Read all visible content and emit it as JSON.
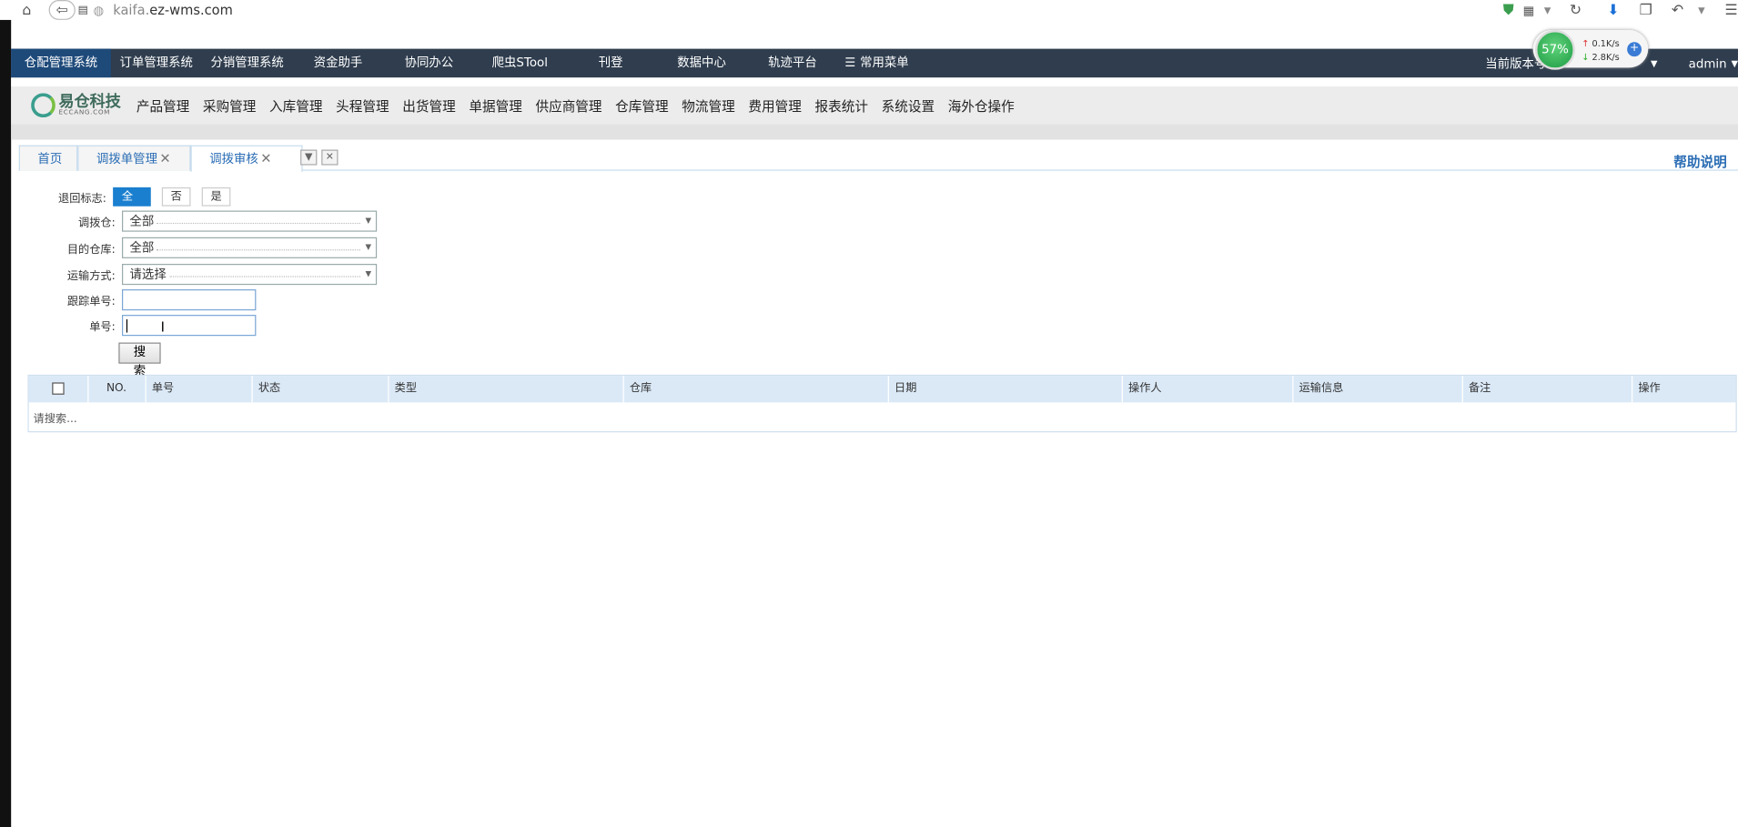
{
  "browser": {
    "url_dim": "kaifa.",
    "url_main": "ez-wms.com",
    "icons": [
      "home-icon",
      "back-icon",
      "reader-icon",
      "globe-icon",
      "shield-icon",
      "qr-icon",
      "reload-icon",
      "download-icon",
      "window-icon",
      "undo-icon",
      "menu-icon"
    ]
  },
  "speed_widget": {
    "percent": "57%",
    "up": "0.1K/s",
    "down": "2.8K/s"
  },
  "topnav": {
    "items": [
      "仓配管理系统",
      "订单管理系统",
      "分销管理系统",
      "资金助手",
      "协同办公",
      "爬虫STool",
      "刊登",
      "数据中心",
      "轨迹平台"
    ],
    "menu_label": "常用菜单",
    "version_label": "当前版本号:D",
    "user": "admin"
  },
  "logo": {
    "cn": "易仓科技",
    "en": "ECCANG.COM"
  },
  "mainnav": [
    "产品管理",
    "采购管理",
    "入库管理",
    "头程管理",
    "出货管理",
    "单据管理",
    "供应商管理",
    "仓库管理",
    "物流管理",
    "费用管理",
    "报表统计",
    "系统设置",
    "海外仓操作"
  ],
  "tabs": [
    {
      "label": "首页",
      "closable": false
    },
    {
      "label": "调拨单管理",
      "closable": true
    },
    {
      "label": "调拨审核",
      "closable": true
    }
  ],
  "help_label": "帮助说明",
  "form": {
    "return_flag_label": "退回标志:",
    "return_flag_options": [
      "全部",
      "否",
      "是"
    ],
    "source_wh_label": "调拨仓:",
    "source_wh_value": "全部",
    "dest_wh_label": "目的仓库:",
    "dest_wh_value": "全部",
    "shipping_label": "运输方式:",
    "shipping_value": "请选择",
    "tracking_label": "跟踪单号:",
    "tracking_value": "",
    "order_label": "单号:",
    "order_value": "",
    "search_button": "搜索"
  },
  "grid": {
    "columns": [
      "NO.",
      "单号",
      "状态",
      "类型",
      "仓库",
      "日期",
      "操作人",
      "运输信息",
      "备注",
      "操作"
    ],
    "empty_text": "请搜索..."
  }
}
